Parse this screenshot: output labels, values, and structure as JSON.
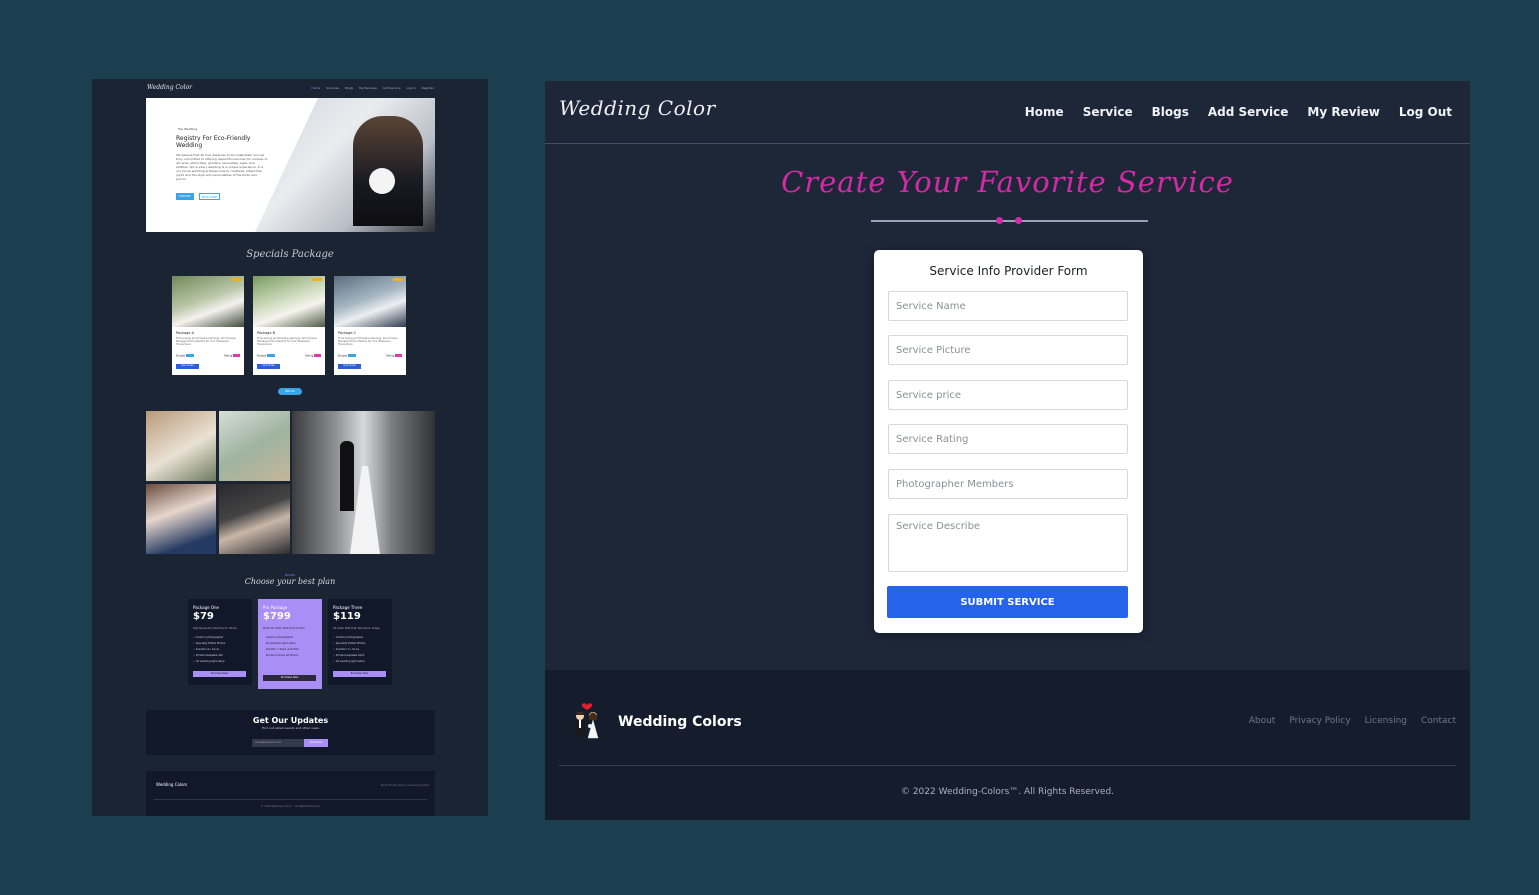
{
  "preview": {
    "brand": "Wedding Color",
    "nav": [
      "Home",
      "Services",
      "Blogs",
      "My Reviews",
      "Add Service",
      "Log In",
      "Register"
    ],
    "hero": {
      "tag": "Top Wedding",
      "title": "Registry For Eco-Friendly Wedding",
      "text": "We believe that all love deserves to be celebrated, and we truly committed to offering respectful services for couples of all races, ethnicities, genders, sexualities, ages, and abilities. Since every wedding is a unique experience, it is our job as wedding professionals to creatively reflect this joyful and the style and personalities of the bride and groom.",
      "btn_primary": "EXPLORE",
      "btn_secondary": "READ MORE"
    },
    "specials_title": "Specials Package",
    "packages": [
      {
        "title": "Package A",
        "desc": "Time saving and timeline planning. All Inclusive Package That is Perfect for Your Treasured Honeymoon",
        "budget": "Budget",
        "rating": "Rating",
        "btn": "VIEW DETAIL"
      },
      {
        "title": "Package B",
        "desc": "Time saving and timeline planning. All Inclusive Package That is Perfect for Your Treasured Honeymoon",
        "budget": "Budget",
        "rating": "Rating",
        "btn": "VIEW DETAIL"
      },
      {
        "title": "Package C",
        "desc": "Time saving and timeline planning. All Inclusive Package That is Perfect for Your Treasured Honeymoon",
        "budget": "Budget",
        "rating": "Rating",
        "btn": "VIEW DETAIL"
      }
    ],
    "see_all": "SEE ALL",
    "pricing_tag": "PRICING",
    "pricing_title": "Choose your best plan",
    "plans": [
      {
        "name": "Package One",
        "price": "$79",
        "sub": "High Resolution JPG Files for Album",
        "features": [
          "Custom photographer",
          "Specialty Edited Photos",
          "Duration 6+ hours",
          "Printed keepsake 4x6",
          "All wedding light setup"
        ],
        "btn": "Purchase Now"
      },
      {
        "name": "Pro Package",
        "price": "$799",
        "sub": "Photo 4K Video With More Picture",
        "features": [
          "Custom photographer",
          "All elements light setup",
          "Duration 7 Days unlimited",
          "Printed Colored All Photos"
        ],
        "btn": "Purchase Now"
      },
      {
        "name": "Package Three",
        "price": "$119",
        "sub": "4K Video With High Resolution Image",
        "features": [
          "Custom photographer",
          "Specialty Edited Photos",
          "Duration 7+ hours",
          "Printed keepsake 6x10",
          "All wedding light setup"
        ],
        "btn": "Purchase Now"
      }
    ],
    "updates": {
      "title": "Get Our Updates",
      "sub": "Find out about events and other news",
      "placeholder": "email@example.com",
      "btn": "Subscribe"
    },
    "footer": {
      "brand": "Wedding Colors",
      "links": "About   Privacy Policy   Licensing   Contact",
      "copy": "© 2022 Wedding-Colors™. All Rights Reserved."
    }
  },
  "main": {
    "brand": "Wedding Color",
    "nav": [
      "Home",
      "Service",
      "Blogs",
      "Add Service",
      "My Review",
      "Log Out"
    ],
    "title": "Create Your Favorite Service",
    "accent_color": "#d42aa5",
    "form": {
      "title": "Service Info Provider Form",
      "placeholders": {
        "service_name": "Service Name",
        "service_picture": "Service Picture",
        "service_price": "Service price",
        "service_rating": "Service Rating",
        "photographer_members": "Photographer Members",
        "service_describe": "Service Describe"
      },
      "submit": "SUBMIT SERVICE",
      "submit_color": "#2563eb"
    },
    "footer": {
      "brand": "Wedding Colors",
      "links": [
        "About",
        "Privacy Policy",
        "Licensing",
        "Contact"
      ],
      "copyright": "© 2022 Wedding-Colors™. All Rights Reserved."
    }
  }
}
